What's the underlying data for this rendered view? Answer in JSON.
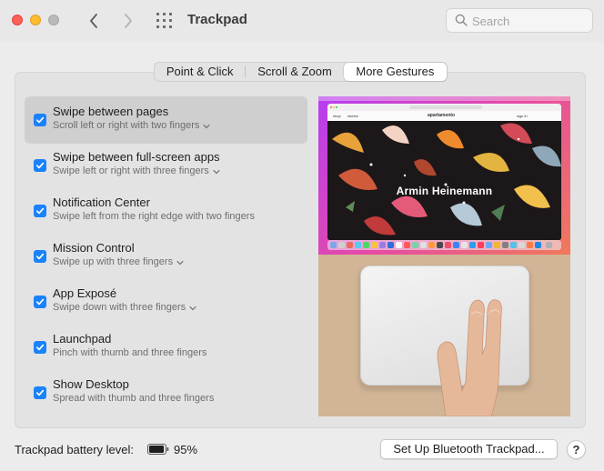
{
  "window": {
    "title": "Trackpad"
  },
  "search": {
    "placeholder": "Search",
    "value": ""
  },
  "tabs": [
    {
      "label": "Point & Click",
      "active": false
    },
    {
      "label": "Scroll & Zoom",
      "active": false
    },
    {
      "label": "More Gestures",
      "active": true
    }
  ],
  "options": [
    {
      "title": "Swipe between pages",
      "subtitle": "Scroll left or right with two fingers",
      "checked": true,
      "has_menu": true,
      "selected": true
    },
    {
      "title": "Swipe between full-screen apps",
      "subtitle": "Swipe left or right with three fingers",
      "checked": true,
      "has_menu": true,
      "selected": false
    },
    {
      "title": "Notification Center",
      "subtitle": "Swipe left from the right edge with two fingers",
      "checked": true,
      "has_menu": false,
      "selected": false
    },
    {
      "title": "Mission Control",
      "subtitle": "Swipe up with three fingers",
      "checked": true,
      "has_menu": true,
      "selected": false
    },
    {
      "title": "App Exposé",
      "subtitle": "Swipe down with three fingers",
      "checked": true,
      "has_menu": true,
      "selected": false
    },
    {
      "title": "Launchpad",
      "subtitle": "Pinch with thumb and three fingers",
      "checked": true,
      "has_menu": false,
      "selected": false
    },
    {
      "title": "Show Desktop",
      "subtitle": "Spread with thumb and three fingers",
      "checked": true,
      "has_menu": false,
      "selected": false
    }
  ],
  "preview": {
    "site_name": "apartamento",
    "nav_left": [
      "shop",
      "stories"
    ],
    "nav_right": "sign in",
    "hero_text": "Armin Heinemann"
  },
  "footer": {
    "battery_label": "Trackpad battery level:",
    "battery_percent": "95%",
    "battery_level": 0.95,
    "setup_button": "Set Up Bluetooth Trackpad...",
    "help_button": "?"
  },
  "colors": {
    "accent": "#1a82fb",
    "close": "#fe5f57",
    "minimize": "#febc2e",
    "zoom_disabled": "#b9b9b9"
  }
}
